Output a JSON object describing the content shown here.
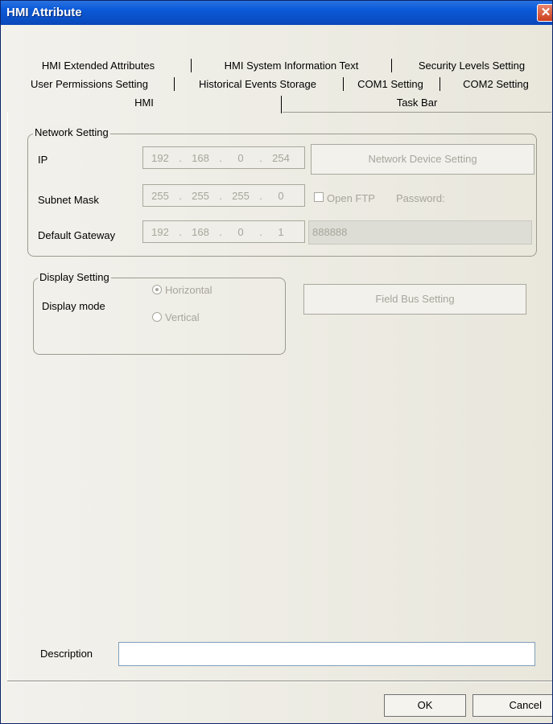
{
  "window": {
    "title": "HMI Attribute",
    "close_glyph": "✕"
  },
  "tabs": {
    "row1": [
      "HMI Extended Attributes",
      "HMI System Information Text",
      "Security Levels Setting"
    ],
    "row2": [
      "User Permissions Setting",
      "Historical Events Storage",
      "COM1 Setting",
      "COM2 Setting"
    ],
    "row3": [
      "HMI",
      "Task Bar"
    ],
    "active": "HMI"
  },
  "network": {
    "legend": "Network Setting",
    "ip_label": "IP",
    "ip": [
      "192",
      "168",
      "0",
      "254"
    ],
    "subnet_label": "Subnet Mask",
    "subnet": [
      "255",
      "255",
      "255",
      "0"
    ],
    "gateway_label": "Default Gateway",
    "gateway": [
      "192",
      "168",
      "0",
      "1"
    ],
    "dot": ".",
    "device_button": "Network Device Setting",
    "open_ftp_label": "Open FTP",
    "password_label": "Password:",
    "password_value": "888888"
  },
  "display": {
    "legend": "Display Setting",
    "mode_label": "Display mode",
    "horizontal": "Horizontal",
    "vertical": "Vertical",
    "selected": "Horizontal",
    "fieldbus_button": "Field Bus Setting"
  },
  "description": {
    "label": "Description",
    "value": ""
  },
  "footer": {
    "ok": "OK",
    "cancel": "Cancel"
  }
}
